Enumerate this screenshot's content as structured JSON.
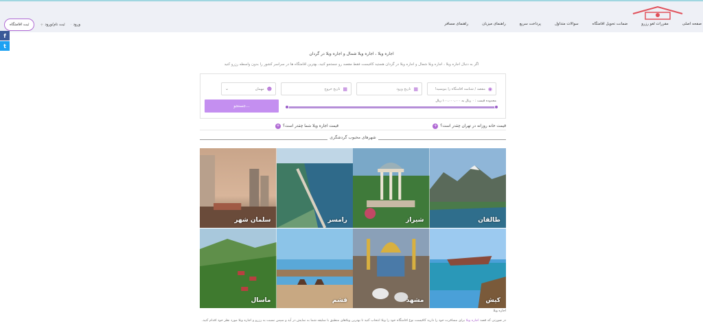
{
  "header": {
    "nav": [
      "صفحه اصلی",
      "مقررات لغو رزرو",
      "ضمانت تحویل اقامتگاه",
      "سوالات متداول",
      "پرداخت سریع",
      "راهنمای میزبان",
      "راهنمای مسافر"
    ],
    "register_button": "ثبت اقامتگاه",
    "signup_label": "ثبت نام/ورود",
    "login_label": "ورود"
  },
  "social": {
    "facebook": "f",
    "twitter": "t"
  },
  "intro": {
    "title": "اجاره ویلا ، اجاره ویلا شمال و اجاره ویلا در گردان",
    "subtitle": "اگر به دنبال اجاره ویلا ، اجاره ویلا شمال و اجاره ویلا در گردان هستید کافیست فقط مقصد رو جستجو کنید، بهترین اقامتگاه ها در سراسر کشور را بدون واسطه رزرو کنید"
  },
  "search": {
    "destination_placeholder": "مقصد / شناسه اقامتگاه را بنویسید!",
    "checkin_placeholder": "تاریخ ورود",
    "checkout_placeholder": "تاریخ خروج",
    "guests_placeholder": "مهمان",
    "price_range": "محدوده قیمت : ۰ ریال به ۱۰۰،۰۰۰،۰۰۰ ریال",
    "price_slider_min_fraction": 0,
    "price_slider_max_fraction": 1,
    "search_button": "جستجو..."
  },
  "faq": {
    "q1": "قیمت خانه روزانه در تهران چقدر است؟",
    "q2": "قیمت اجاره ویلا شما چقدر است؟"
  },
  "section_title": "شهرهای محبوب گردشگری",
  "cities": [
    {
      "name": "طالقان"
    },
    {
      "name": "شیراز"
    },
    {
      "name": "رامسر"
    },
    {
      "name": "سلمان شهر"
    },
    {
      "name": "کیش"
    },
    {
      "name": "مشهد"
    },
    {
      "name": "قشم"
    },
    {
      "name": "ماسال"
    }
  ],
  "caption": "اجاره ویلا",
  "footer_text": {
    "before": "در صورتی که قصد ",
    "link": "اجاره ویلا",
    "after": " برای مسافرت خود را دارید کافیست نوع اقامتگاه خود را ویلا انتخاب کنید تا بهترین ویلاهای منطبق با سلیقه شما به نمایش در آید و سپس نسبت به رزرو و اجاره ویلا مورد نظر خود اقدام کنید."
  },
  "colors": {
    "accent": "#b06ad4",
    "button": "#c48ff0",
    "header_bg": "#eef0f6"
  }
}
